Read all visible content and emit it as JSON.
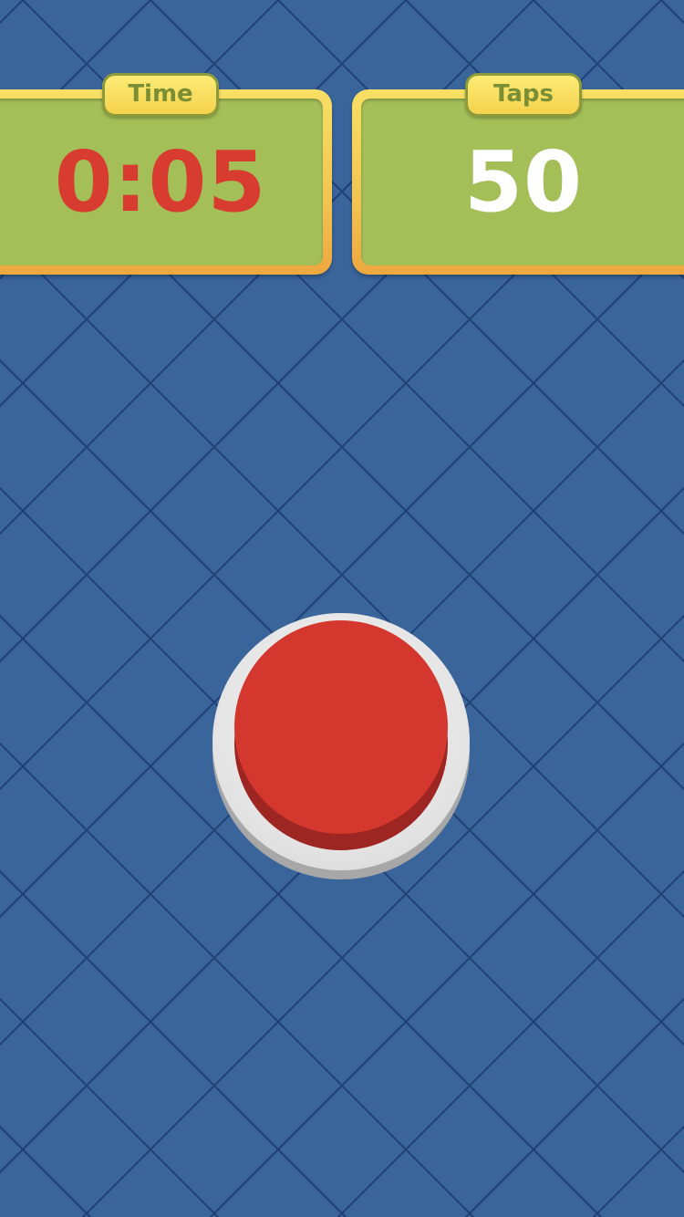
{
  "time_panel": {
    "label": "Time",
    "value": "0:05"
  },
  "taps_panel": {
    "label": "Taps",
    "value": "50"
  },
  "tap_button": {
    "icon": "big-red-button",
    "color": "#d3372d"
  },
  "colors": {
    "background": "#3a659b",
    "grid_lines": "#1e3f73",
    "panel_fill": "#a4bf58",
    "panel_border": "#f2c452",
    "time_value": "#d83b30",
    "taps_value": "#ffffff"
  }
}
